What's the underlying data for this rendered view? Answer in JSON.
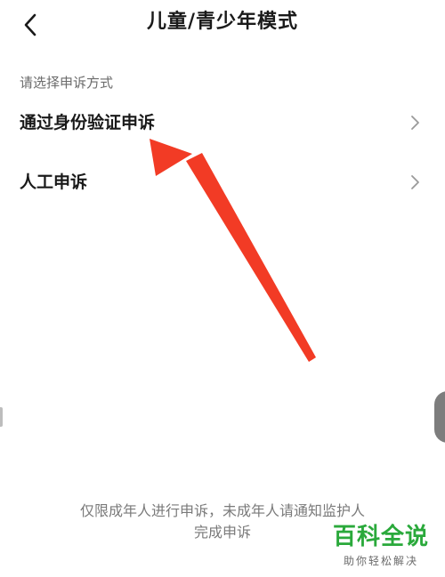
{
  "header": {
    "title": "儿童/青少年模式",
    "back_icon": "chevron-left-icon"
  },
  "appeal": {
    "section_label": "请选择申诉方式",
    "items": [
      {
        "label": "通过身份验证申诉",
        "icon": "chevron-right-icon"
      },
      {
        "label": "人工申诉",
        "icon": "chevron-right-icon"
      }
    ]
  },
  "footer": {
    "note_line1": "仅限成年人进行申诉，未成年人请通知监护人",
    "note_line2": "完成申诉"
  },
  "watermark": {
    "title": "百科全说",
    "subtitle": "助你轻松解决"
  },
  "colors": {
    "annotation_arrow": "#f23b25",
    "watermark_green": "#2aa93b",
    "secondary_text": "#7a7a7a"
  }
}
